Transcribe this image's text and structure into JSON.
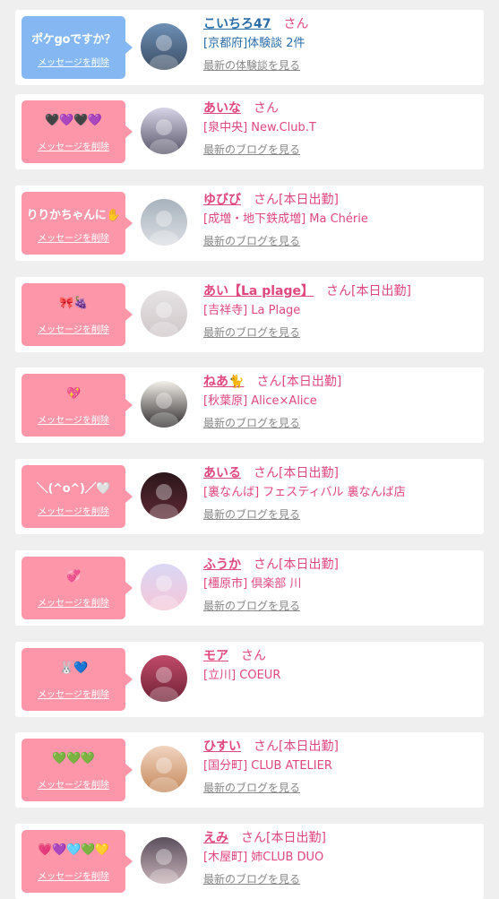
{
  "items": [
    {
      "message": "ポケgoですか？",
      "delete_label": "メッセージを削除",
      "name": "こいちろ47",
      "san": "さん",
      "status": "",
      "shop": "[京都府]体験談 2件",
      "link": "最新の体験談を見る",
      "theme": "blue",
      "avatar_colors": [
        "#6d8fb6",
        "#3c4d63"
      ]
    },
    {
      "message": "🖤💜🖤💜",
      "delete_label": "メッセージを削除",
      "name": "あいな",
      "san": "さん",
      "status": "",
      "shop": "[泉中央] New.Club.T",
      "link": "最新のブログを見る",
      "theme": "pink",
      "avatar_colors": [
        "#d8d4e8",
        "#5a566a"
      ]
    },
    {
      "message": "りりかちゃんに✋",
      "delete_label": "メッセージを削除",
      "name": "ゆびび",
      "san": "さん",
      "status": "[本日出勤]",
      "shop": "[成増・地下鉄成増] Ma Chérie",
      "link": "最新のブログを見る",
      "theme": "pink",
      "avatar_colors": [
        "#a7b2bd",
        "#dcdfe3"
      ]
    },
    {
      "message": "🎀🍇",
      "delete_label": "メッセージを削除",
      "name": "あい【La plage】",
      "san": "さん",
      "status": "[本日出勤]",
      "shop": "[吉祥寺] La Plage",
      "link": "最新のブログを見る",
      "theme": "pink",
      "avatar_colors": [
        "#e6e3e4",
        "#cfc7c9"
      ]
    },
    {
      "message": "💖",
      "delete_label": "メッセージを削除",
      "name": "ねあ🐈",
      "san": "さん",
      "status": "[本日出勤]",
      "shop": "[秋葉原] Alice×Alice",
      "link": "最新のブログを見る",
      "theme": "pink",
      "avatar_colors": [
        "#f3efe9",
        "#2e2a2c"
      ]
    },
    {
      "message": "＼(^o^)／🤍",
      "delete_label": "メッセージを削除",
      "name": "あいる",
      "san": "さん",
      "status": "[本日出勤]",
      "shop": "[裏なんば] フェスティバル 裏なんば店",
      "link": "最新のブログを見る",
      "theme": "pink",
      "avatar_colors": [
        "#2b171b",
        "#5c2833"
      ]
    },
    {
      "message": "💞",
      "delete_label": "メッセージを削除",
      "name": "ふうか",
      "san": "さん",
      "status": "[本日出勤]",
      "shop": "[橿原市] 倶楽部 川",
      "link": "最新のブログを見る",
      "theme": "pink",
      "avatar_colors": [
        "#d9d7f5",
        "#f6c6d8"
      ]
    },
    {
      "message": "🐰💙",
      "delete_label": "メッセージを削除",
      "name": "モア",
      "san": "さん",
      "status": "",
      "shop": "[立川] COEUR",
      "link": "",
      "theme": "pink",
      "avatar_colors": [
        "#c04a6a",
        "#6f2236"
      ]
    },
    {
      "message": "💚💚💚",
      "delete_label": "メッセージを削除",
      "name": "ひすい",
      "san": "さん",
      "status": "[本日出勤]",
      "shop": "[国分町] CLUB ATELIER",
      "link": "最新のブログを見る",
      "theme": "pink",
      "avatar_colors": [
        "#f1d4c0",
        "#c68a5c"
      ]
    },
    {
      "message": "💗💜🩵💚💛",
      "delete_label": "メッセージを削除",
      "name": "えみ",
      "san": "さん",
      "status": "[本日出勤]",
      "shop": "[木屋町] 姉CLUB DUO",
      "link": "最新のブログを見る",
      "theme": "pink",
      "avatar_colors": [
        "#5b4f5d",
        "#c7b2b7"
      ]
    }
  ]
}
